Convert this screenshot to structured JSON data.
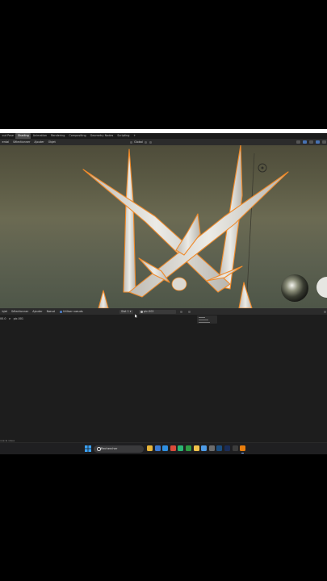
{
  "tabs": [
    "out Pose",
    "Shading",
    "Animation",
    "Rendering",
    "Compositing",
    "Geometry Nodes",
    "Scripting",
    "+"
  ],
  "active_tab_index": 1,
  "viewport_header": {
    "menus": [
      "ental",
      "Sélectionner",
      "Ajouter",
      "Objet"
    ],
    "view_mode_label": "Global"
  },
  "node_header": {
    "menus": [
      "bjet",
      "Sélectionner",
      "Ajouter",
      "Nœud"
    ],
    "use_nodes_label": "Utiliser nœuds",
    "slot_label": "Slot 1",
    "material_name": "pic.002"
  },
  "breadcrumb": {
    "first": "00.0",
    "sep": ">",
    "second": "pic.001"
  },
  "status_text": "uue la visue",
  "taskbar": {
    "search_placeholder": "Rechercher",
    "apps": [
      {
        "name": "file-explorer-icon",
        "color": "#e8b53a"
      },
      {
        "name": "mail-icon",
        "color": "#3b7bd4"
      },
      {
        "name": "store-icon",
        "color": "#2f8fe0"
      },
      {
        "name": "chrome-icon",
        "color": "#d94b3a"
      },
      {
        "name": "edge-icon",
        "color": "#2bb673"
      },
      {
        "name": "xbox-icon",
        "color": "#2e9b43"
      },
      {
        "name": "folder-icon",
        "color": "#f0c24b"
      },
      {
        "name": "photos-icon",
        "color": "#4e9be6"
      },
      {
        "name": "video-icon",
        "color": "#6c6c6c"
      },
      {
        "name": "steam-icon",
        "color": "#1b4f82"
      },
      {
        "name": "photoshop-icon",
        "color": "#1a2d58"
      },
      {
        "name": "obs-icon",
        "color": "#3c3c3c"
      },
      {
        "name": "blender-icon",
        "color": "#e87d0d"
      }
    ]
  },
  "colors": {
    "accent": "#4772b3",
    "selection_outline": "#f08a2a",
    "model": "#d9d6d0"
  }
}
